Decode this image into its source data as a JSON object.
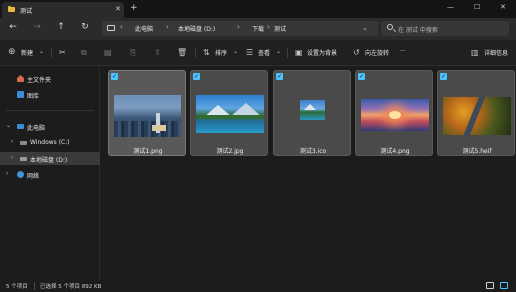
{
  "window": {
    "tab_title": "测试",
    "tab_close": "✕",
    "new_tab": "+",
    "minimize": "—",
    "maximize": "☐",
    "close": "✕"
  },
  "nav": {
    "back": "←",
    "forward": "→",
    "up": "↑",
    "refresh": "↻",
    "breadcrumb": [
      "此电脑",
      "本地磁盘 (D:)",
      "下载",
      "测试"
    ],
    "search_placeholder": "在 测试 中搜索"
  },
  "toolbar": {
    "new_label": "新建",
    "sort_label": "排序",
    "view_label": "查看",
    "set_background_label": "设置为背景",
    "rotate_left_label": "向左旋转",
    "more": "···",
    "details_label": "详细信息"
  },
  "sidebar": {
    "items": [
      {
        "label": "主文件夹"
      },
      {
        "label": "图库"
      },
      {
        "label": "此电脑"
      },
      {
        "label": "Windows (C:)"
      },
      {
        "label": "本地磁盘 (D:)"
      },
      {
        "label": "网络"
      }
    ]
  },
  "files": [
    {
      "name": "测试1.png",
      "icon": "city-night-thumbnail"
    },
    {
      "name": "测试2.jpg",
      "icon": "lake-mountain-thumbnail"
    },
    {
      "name": "测试3.ico",
      "icon": "icon-file-thumbnail"
    },
    {
      "name": "测试4.png",
      "icon": "sunset-thumbnail"
    },
    {
      "name": "测试5.heif",
      "icon": "autumn-road-thumbnail"
    }
  ],
  "status": {
    "count": "5 个项目",
    "selected": "已选择 5 个项目  892 KB"
  },
  "colors": {
    "accent": "#4cc2ff",
    "folder": "#e9b83a"
  }
}
